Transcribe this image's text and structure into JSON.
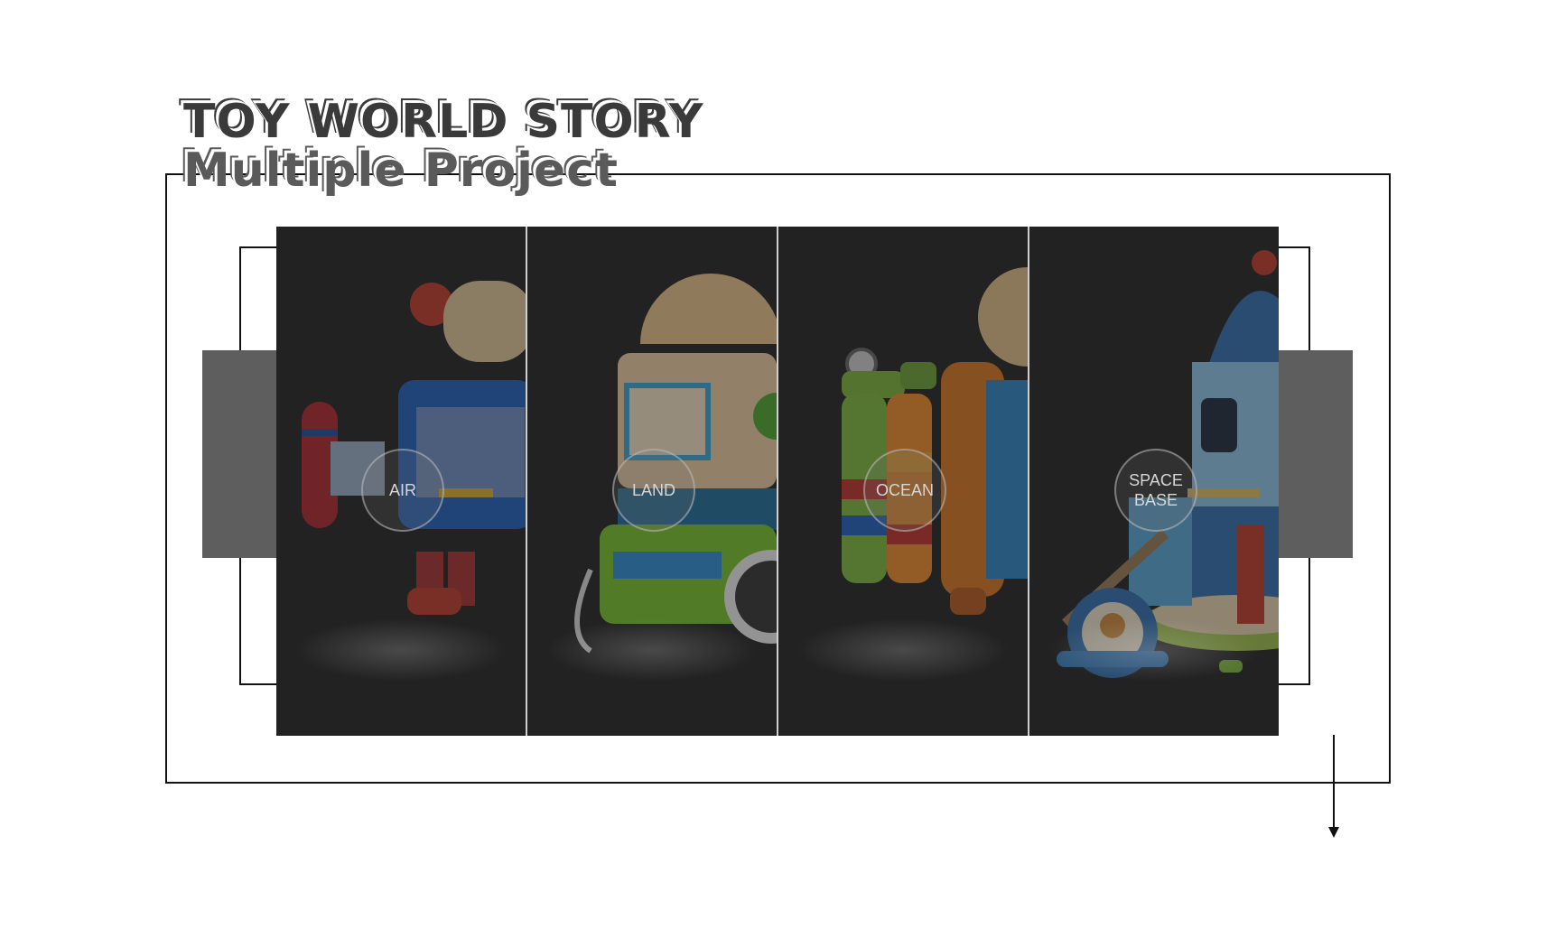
{
  "header": {
    "title": "TOY WORLD STORY",
    "subtitle": "Multiple Project"
  },
  "projects": [
    {
      "label": "AIR",
      "icon": "air-robot-toy"
    },
    {
      "label": "LAND",
      "icon": "land-robot-toy"
    },
    {
      "label": "OCEAN",
      "icon": "ocean-diver-toy"
    },
    {
      "label": "SPACE\nBASE",
      "icon": "space-base-toy"
    }
  ],
  "colors": {
    "panel_background": "#222222",
    "side_block": "#5e5e5e",
    "frame": "#111111",
    "title": "#3a3a3a"
  }
}
